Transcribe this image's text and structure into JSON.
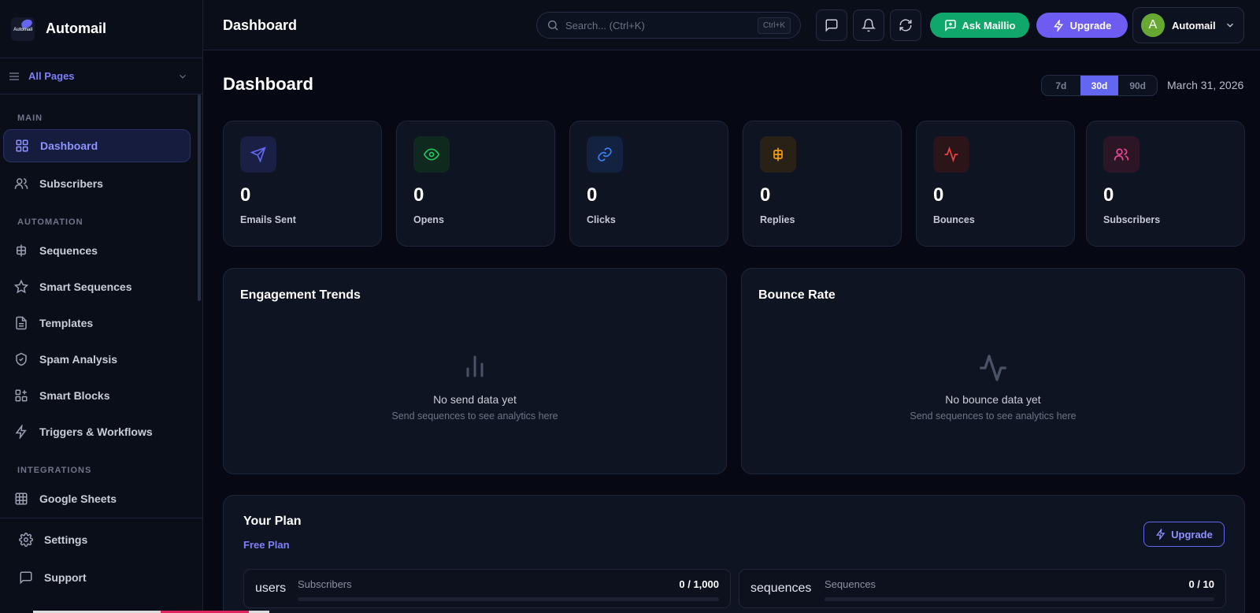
{
  "brand": {
    "name": "Automail",
    "logo_text": "Automail"
  },
  "sidebar": {
    "all_pages_label": "All Pages",
    "sections": [
      "MAIN",
      "AUTOMATION",
      "INTEGRATIONS"
    ],
    "items": [
      {
        "label": "Dashboard",
        "icon": "grid-icon",
        "active": true
      },
      {
        "label": "Subscribers",
        "icon": "users-icon"
      },
      {
        "label": "Sequences",
        "icon": "sequence-icon"
      },
      {
        "label": "Smart Sequences",
        "icon": "star-icon"
      },
      {
        "label": "Templates",
        "icon": "file-icon"
      },
      {
        "label": "Spam Analysis",
        "icon": "shield-icon"
      },
      {
        "label": "Smart Blocks",
        "icon": "blocks-icon"
      },
      {
        "label": "Triggers & Workflows",
        "icon": "zap-icon"
      },
      {
        "label": "Google Sheets",
        "icon": "table-icon"
      }
    ],
    "bottom": [
      {
        "label": "Settings",
        "icon": "gear-icon"
      },
      {
        "label": "Support",
        "icon": "message-icon"
      }
    ]
  },
  "header": {
    "title": "Dashboard",
    "search_placeholder": "Search... (Ctrl+K)",
    "search_shortcut": "Ctrl+K",
    "ask_label": "Ask Maillio",
    "upgrade_label": "Upgrade",
    "account_name": "Automail",
    "avatar_initial": "A"
  },
  "main": {
    "title": "Dashboard",
    "ranges": [
      "7d",
      "30d",
      "90d"
    ],
    "selected_range": "30d",
    "date": "March 31, 2026",
    "stats": [
      {
        "value": "0",
        "label": "Emails Sent",
        "icon": "send-icon",
        "color": "#6366f1"
      },
      {
        "value": "0",
        "label": "Opens",
        "icon": "eye-icon",
        "color": "#22c55e"
      },
      {
        "value": "0",
        "label": "Clicks",
        "icon": "link-icon",
        "color": "#3b82f6"
      },
      {
        "value": "0",
        "label": "Replies",
        "icon": "sequence-icon",
        "color": "#f59e0b"
      },
      {
        "value": "0",
        "label": "Bounces",
        "icon": "activity-icon",
        "color": "#ef4444"
      },
      {
        "value": "0",
        "label": "Subscribers",
        "icon": "users-icon",
        "color": "#ec4899"
      }
    ],
    "panels": [
      {
        "title": "Engagement Trends",
        "empty_title": "No send data yet",
        "empty_sub": "Send sequences to see analytics here",
        "icon": "bar-chart-icon"
      },
      {
        "title": "Bounce Rate",
        "empty_title": "No bounce data yet",
        "empty_sub": "Send sequences to see analytics here",
        "icon": "activity-icon"
      }
    ],
    "plan": {
      "title": "Your Plan",
      "name": "Free Plan",
      "upgrade_label": "Upgrade",
      "usage": [
        {
          "key": "users",
          "label": "Subscribers",
          "value": "0 / 1,000",
          "fraction": 0
        },
        {
          "key": "sequences",
          "label": "Sequences",
          "value": "0 / 10",
          "fraction": 0
        }
      ]
    }
  },
  "colors": {
    "accent": "#6366f1",
    "ask": "#10a86a",
    "upgrade": "#6d5cf2",
    "background": "#060914"
  }
}
